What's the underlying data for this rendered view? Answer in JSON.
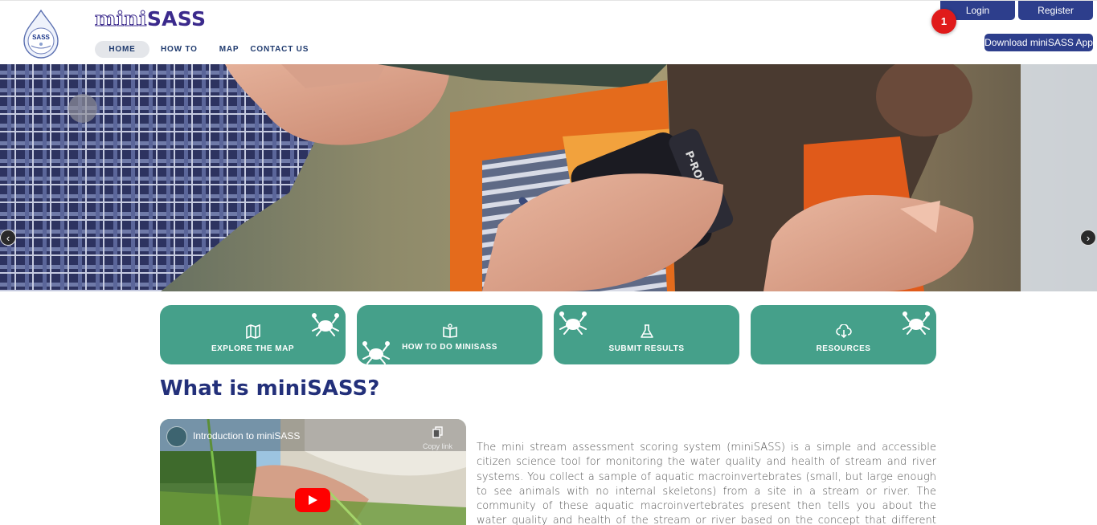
{
  "header": {
    "brand_mini": "mini",
    "brand_sass": "SASS",
    "logo_text": "SASS",
    "nav": {
      "home": "HOME",
      "how_to": "HOW TO",
      "map": "MAP",
      "contact": "CONTACT US"
    },
    "login_label": "Login",
    "register_label": "Register",
    "download_label": "Download miniSASS App",
    "notification_count": "1"
  },
  "hero": {
    "prev_icon": "chevron-left-icon",
    "next_icon": "chevron-right-icon",
    "lens_text": "P-ROKKOR"
  },
  "cards": [
    {
      "label": "EXPLORE THE MAP",
      "icon": "map-icon"
    },
    {
      "label": "HOW TO DO MINISASS",
      "icon": "book-icon"
    },
    {
      "label": "SUBMIT RESULTS",
      "icon": "flask-icon"
    },
    {
      "label": "RESOURCES",
      "icon": "cloud-download-icon"
    }
  ],
  "main": {
    "title": "What is miniSASS?",
    "video": {
      "title": "Introduction to miniSASS",
      "copy_link": "Copy link"
    },
    "description": "The mini stream assessment scoring system (miniSASS) is a simple and accessible citizen science tool for monitoring the water quality and health of stream and river systems. You collect a sample of aquatic macroinvertebrates (small, but large enough to see animals with no internal skeletons) from a site in a stream or river. The community of these aquatic macroinvertebrates present then tells you about the water quality and health of the stream or river based on the concept that different groups of aquatic"
  },
  "colors": {
    "primary": "#2d3e8c",
    "card": "#45a08a",
    "title": "#23307a",
    "badge": "#e01a1a"
  }
}
